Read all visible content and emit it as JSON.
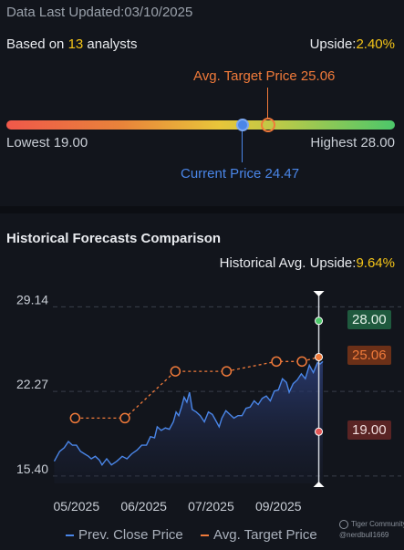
{
  "header": {
    "updated": "Data Last Updated:03/10/2025",
    "based_prefix": "Based on ",
    "analyst_count": "13",
    "based_suffix": " analysts",
    "upside_label": "Upside:",
    "upside_value": "2.40%"
  },
  "gauge": {
    "avg_target_label": "Avg. Target Price 25.06",
    "lowest_label": "Lowest 19.00",
    "highest_label": "Highest 28.00",
    "current_label": "Current Price 24.47",
    "low": 19.0,
    "high": 28.0,
    "current": 24.47,
    "avg_target": 25.06,
    "colors": {
      "red": "#f0584a",
      "yellow": "#e8c63a",
      "green": "#4cc76a",
      "current": "#4a86e8",
      "target": "#f07a3a"
    }
  },
  "historical": {
    "title": "Historical Forecasts Comparison",
    "avg_upside_label": "Historical Avg. Upside:",
    "avg_upside_value": "9.64%",
    "legend_prev": "Prev. Close Price",
    "legend_avg": "Avg. Target Price",
    "watermark_brand": "Tiger Community",
    "watermark_user": "@nerdbull1669",
    "tag_high": "28.00",
    "tag_avg": "25.06",
    "tag_low": "19.00"
  },
  "chart_data": {
    "type": "line",
    "y_ticks": [
      "29.14",
      "22.27",
      "15.40"
    ],
    "y_tick_values": [
      29.14,
      22.27,
      15.4
    ],
    "x_ticks": [
      "05/2025",
      "06/2025",
      "07/2025",
      "09/2025"
    ],
    "x_tick_values": [
      0,
      1,
      2,
      3
    ],
    "ylim": [
      14.8,
      30.5
    ],
    "xlim": [
      -0.35,
      3.85
    ],
    "series": [
      {
        "name": "Prev. Close Price",
        "style": "solid-area",
        "color": "#4a86e8",
        "points": [
          [
            -0.33,
            16.6
          ],
          [
            -0.25,
            17.4
          ],
          [
            -0.18,
            17.7
          ],
          [
            -0.12,
            18.2
          ],
          [
            -0.06,
            17.9
          ],
          [
            0.0,
            17.9
          ],
          [
            0.06,
            17.4
          ],
          [
            0.12,
            17.2
          ],
          [
            0.18,
            17.0
          ],
          [
            0.22,
            16.8
          ],
          [
            0.28,
            17.0
          ],
          [
            0.34,
            16.7
          ],
          [
            0.38,
            16.3
          ],
          [
            0.45,
            16.8
          ],
          [
            0.52,
            16.3
          ],
          [
            0.6,
            16.6
          ],
          [
            0.68,
            17.0
          ],
          [
            0.75,
            16.8
          ],
          [
            0.82,
            17.2
          ],
          [
            0.9,
            17.5
          ],
          [
            0.97,
            17.9
          ],
          [
            1.04,
            17.9
          ],
          [
            1.1,
            18.6
          ],
          [
            1.16,
            18.5
          ],
          [
            1.2,
            19.4
          ],
          [
            1.26,
            19.1
          ],
          [
            1.32,
            19.3
          ],
          [
            1.38,
            19.2
          ],
          [
            1.44,
            19.8
          ],
          [
            1.48,
            20.6
          ],
          [
            1.52,
            20.3
          ],
          [
            1.56,
            21.0
          ],
          [
            1.6,
            21.8
          ],
          [
            1.64,
            21.4
          ],
          [
            1.68,
            22.2
          ],
          [
            1.72,
            20.8
          ],
          [
            1.78,
            20.6
          ],
          [
            1.84,
            20.3
          ],
          [
            1.9,
            19.8
          ],
          [
            1.96,
            20.6
          ],
          [
            2.02,
            20.4
          ],
          [
            2.08,
            19.8
          ],
          [
            2.12,
            19.4
          ],
          [
            2.16,
            20.1
          ],
          [
            2.22,
            20.7
          ],
          [
            2.28,
            20.4
          ],
          [
            2.34,
            20.1
          ],
          [
            2.4,
            20.3
          ],
          [
            2.46,
            20.3
          ],
          [
            2.52,
            20.9
          ],
          [
            2.58,
            21.0
          ],
          [
            2.64,
            21.5
          ],
          [
            2.7,
            21.2
          ],
          [
            2.76,
            21.7
          ],
          [
            2.82,
            21.9
          ],
          [
            2.88,
            21.5
          ],
          [
            2.94,
            22.3
          ],
          [
            3.0,
            22.4
          ],
          [
            3.06,
            23.3
          ],
          [
            3.12,
            23.0
          ],
          [
            3.16,
            22.2
          ],
          [
            3.22,
            22.9
          ],
          [
            3.28,
            23.2
          ],
          [
            3.34,
            23.7
          ],
          [
            3.4,
            23.3
          ],
          [
            3.46,
            24.4
          ],
          [
            3.52,
            23.8
          ],
          [
            3.58,
            24.6
          ],
          [
            3.62,
            24.5
          ],
          [
            3.66,
            24.7
          ]
        ]
      },
      {
        "name": "Avg. Target Price",
        "style": "dashed-markers",
        "color": "#f07a3a",
        "points": [
          [
            -0.02,
            20.1
          ],
          [
            0.72,
            20.1
          ],
          [
            1.47,
            23.9
          ],
          [
            2.23,
            23.9
          ],
          [
            2.97,
            24.7
          ],
          [
            3.35,
            24.7
          ],
          [
            3.6,
            25.06
          ]
        ]
      }
    ],
    "forecast_markers": [
      {
        "label": "28.00",
        "value": 28.0,
        "color": "#4cc76a"
      },
      {
        "label": "25.06",
        "value": 25.06,
        "color": "#f07a3a"
      },
      {
        "label": "19.00",
        "value": 19.0,
        "color": "#e05555"
      }
    ]
  }
}
